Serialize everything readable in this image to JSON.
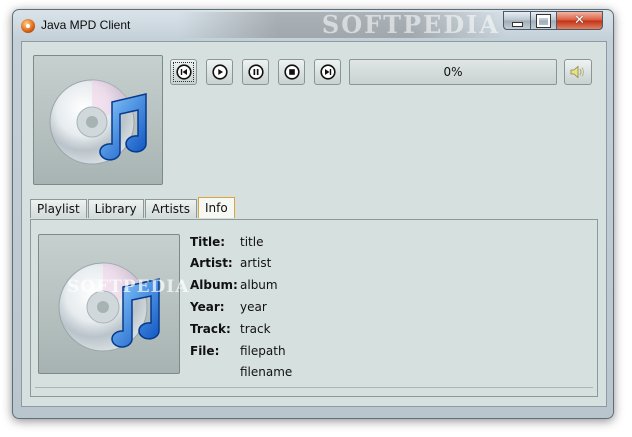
{
  "window": {
    "title": "Java MPD Client",
    "watermark": "SOFTPEDIA"
  },
  "controls": {
    "progress_text": "0%",
    "buttons": [
      {
        "name": "previous-track-button",
        "icon": "skip-back-icon"
      },
      {
        "name": "play-button",
        "icon": "play-icon"
      },
      {
        "name": "pause-button",
        "icon": "pause-icon"
      },
      {
        "name": "stop-button",
        "icon": "stop-icon"
      },
      {
        "name": "next-track-button",
        "icon": "skip-forward-icon"
      }
    ],
    "volume_icon": "speaker-icon"
  },
  "tabs": [
    {
      "label": "Playlist"
    },
    {
      "label": "Library"
    },
    {
      "label": "Artists"
    },
    {
      "label": "Info",
      "active": true
    }
  ],
  "info": {
    "title_label": "Title:",
    "title_value": "title",
    "artist_label": "Artist:",
    "artist_value": "artist",
    "album_label": "Album:",
    "album_value": "album",
    "year_label": "Year:",
    "year_value": "year",
    "track_label": "Track:",
    "track_value": "track",
    "file_label": "File:",
    "file_path": "filepath",
    "file_name": "filename"
  },
  "art_watermark": "SOFTPEDIA",
  "colors": {
    "client_bg": "#d6e0df",
    "active_tab_border": "#d9a441",
    "close_button": "#c03015"
  }
}
